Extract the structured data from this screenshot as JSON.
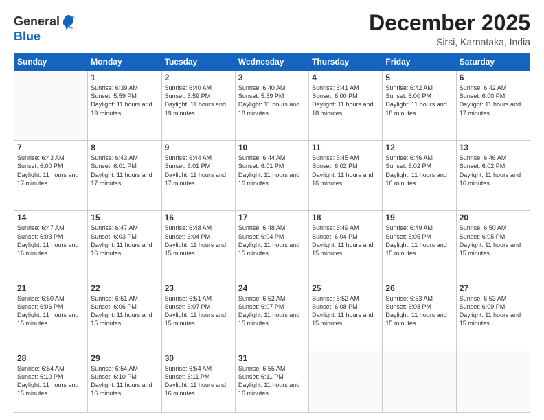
{
  "header": {
    "logo": {
      "line1": "General",
      "line2": "Blue"
    },
    "month": "December 2025",
    "location": "Sirsi, Karnataka, India"
  },
  "weekdays": [
    "Sunday",
    "Monday",
    "Tuesday",
    "Wednesday",
    "Thursday",
    "Friday",
    "Saturday"
  ],
  "weeks": [
    [
      {
        "day": "",
        "empty": true
      },
      {
        "day": "1",
        "sunrise": "Sunrise: 6:39 AM",
        "sunset": "Sunset: 5:59 PM",
        "daylight": "Daylight: 11 hours and 19 minutes."
      },
      {
        "day": "2",
        "sunrise": "Sunrise: 6:40 AM",
        "sunset": "Sunset: 5:59 PM",
        "daylight": "Daylight: 11 hours and 19 minutes."
      },
      {
        "day": "3",
        "sunrise": "Sunrise: 6:40 AM",
        "sunset": "Sunset: 5:59 PM",
        "daylight": "Daylight: 11 hours and 18 minutes."
      },
      {
        "day": "4",
        "sunrise": "Sunrise: 6:41 AM",
        "sunset": "Sunset: 6:00 PM",
        "daylight": "Daylight: 11 hours and 18 minutes."
      },
      {
        "day": "5",
        "sunrise": "Sunrise: 6:42 AM",
        "sunset": "Sunset: 6:00 PM",
        "daylight": "Daylight: 11 hours and 18 minutes."
      },
      {
        "day": "6",
        "sunrise": "Sunrise: 6:42 AM",
        "sunset": "Sunset: 6:00 PM",
        "daylight": "Daylight: 11 hours and 17 minutes."
      }
    ],
    [
      {
        "day": "7",
        "sunrise": "Sunrise: 6:43 AM",
        "sunset": "Sunset: 6:00 PM",
        "daylight": "Daylight: 11 hours and 17 minutes."
      },
      {
        "day": "8",
        "sunrise": "Sunrise: 6:43 AM",
        "sunset": "Sunset: 6:01 PM",
        "daylight": "Daylight: 11 hours and 17 minutes."
      },
      {
        "day": "9",
        "sunrise": "Sunrise: 6:44 AM",
        "sunset": "Sunset: 6:01 PM",
        "daylight": "Daylight: 11 hours and 17 minutes."
      },
      {
        "day": "10",
        "sunrise": "Sunrise: 6:44 AM",
        "sunset": "Sunset: 6:01 PM",
        "daylight": "Daylight: 11 hours and 16 minutes."
      },
      {
        "day": "11",
        "sunrise": "Sunrise: 6:45 AM",
        "sunset": "Sunset: 6:02 PM",
        "daylight": "Daylight: 11 hours and 16 minutes."
      },
      {
        "day": "12",
        "sunrise": "Sunrise: 6:46 AM",
        "sunset": "Sunset: 6:02 PM",
        "daylight": "Daylight: 11 hours and 16 minutes."
      },
      {
        "day": "13",
        "sunrise": "Sunrise: 6:46 AM",
        "sunset": "Sunset: 6:02 PM",
        "daylight": "Daylight: 11 hours and 16 minutes."
      }
    ],
    [
      {
        "day": "14",
        "sunrise": "Sunrise: 6:47 AM",
        "sunset": "Sunset: 6:03 PM",
        "daylight": "Daylight: 11 hours and 16 minutes."
      },
      {
        "day": "15",
        "sunrise": "Sunrise: 6:47 AM",
        "sunset": "Sunset: 6:03 PM",
        "daylight": "Daylight: 11 hours and 16 minutes."
      },
      {
        "day": "16",
        "sunrise": "Sunrise: 6:48 AM",
        "sunset": "Sunset: 6:04 PM",
        "daylight": "Daylight: 11 hours and 15 minutes."
      },
      {
        "day": "17",
        "sunrise": "Sunrise: 6:48 AM",
        "sunset": "Sunset: 6:04 PM",
        "daylight": "Daylight: 11 hours and 15 minutes."
      },
      {
        "day": "18",
        "sunrise": "Sunrise: 6:49 AM",
        "sunset": "Sunset: 6:04 PM",
        "daylight": "Daylight: 11 hours and 15 minutes."
      },
      {
        "day": "19",
        "sunrise": "Sunrise: 6:49 AM",
        "sunset": "Sunset: 6:05 PM",
        "daylight": "Daylight: 11 hours and 15 minutes."
      },
      {
        "day": "20",
        "sunrise": "Sunrise: 6:50 AM",
        "sunset": "Sunset: 6:05 PM",
        "daylight": "Daylight: 11 hours and 15 minutes."
      }
    ],
    [
      {
        "day": "21",
        "sunrise": "Sunrise: 6:50 AM",
        "sunset": "Sunset: 6:06 PM",
        "daylight": "Daylight: 11 hours and 15 minutes."
      },
      {
        "day": "22",
        "sunrise": "Sunrise: 6:51 AM",
        "sunset": "Sunset: 6:06 PM",
        "daylight": "Daylight: 11 hours and 15 minutes."
      },
      {
        "day": "23",
        "sunrise": "Sunrise: 6:51 AM",
        "sunset": "Sunset: 6:07 PM",
        "daylight": "Daylight: 11 hours and 15 minutes."
      },
      {
        "day": "24",
        "sunrise": "Sunrise: 6:52 AM",
        "sunset": "Sunset: 6:07 PM",
        "daylight": "Daylight: 11 hours and 15 minutes."
      },
      {
        "day": "25",
        "sunrise": "Sunrise: 6:52 AM",
        "sunset": "Sunset: 6:08 PM",
        "daylight": "Daylight: 11 hours and 15 minutes."
      },
      {
        "day": "26",
        "sunrise": "Sunrise: 6:53 AM",
        "sunset": "Sunset: 6:08 PM",
        "daylight": "Daylight: 11 hours and 15 minutes."
      },
      {
        "day": "27",
        "sunrise": "Sunrise: 6:53 AM",
        "sunset": "Sunset: 6:09 PM",
        "daylight": "Daylight: 11 hours and 15 minutes."
      }
    ],
    [
      {
        "day": "28",
        "sunrise": "Sunrise: 6:54 AM",
        "sunset": "Sunset: 6:10 PM",
        "daylight": "Daylight: 11 hours and 15 minutes."
      },
      {
        "day": "29",
        "sunrise": "Sunrise: 6:54 AM",
        "sunset": "Sunset: 6:10 PM",
        "daylight": "Daylight: 11 hours and 16 minutes."
      },
      {
        "day": "30",
        "sunrise": "Sunrise: 6:54 AM",
        "sunset": "Sunset: 6:11 PM",
        "daylight": "Daylight: 11 hours and 16 minutes."
      },
      {
        "day": "31",
        "sunrise": "Sunrise: 6:55 AM",
        "sunset": "Sunset: 6:11 PM",
        "daylight": "Daylight: 11 hours and 16 minutes."
      },
      {
        "day": "",
        "empty": true
      },
      {
        "day": "",
        "empty": true
      },
      {
        "day": "",
        "empty": true
      }
    ]
  ]
}
